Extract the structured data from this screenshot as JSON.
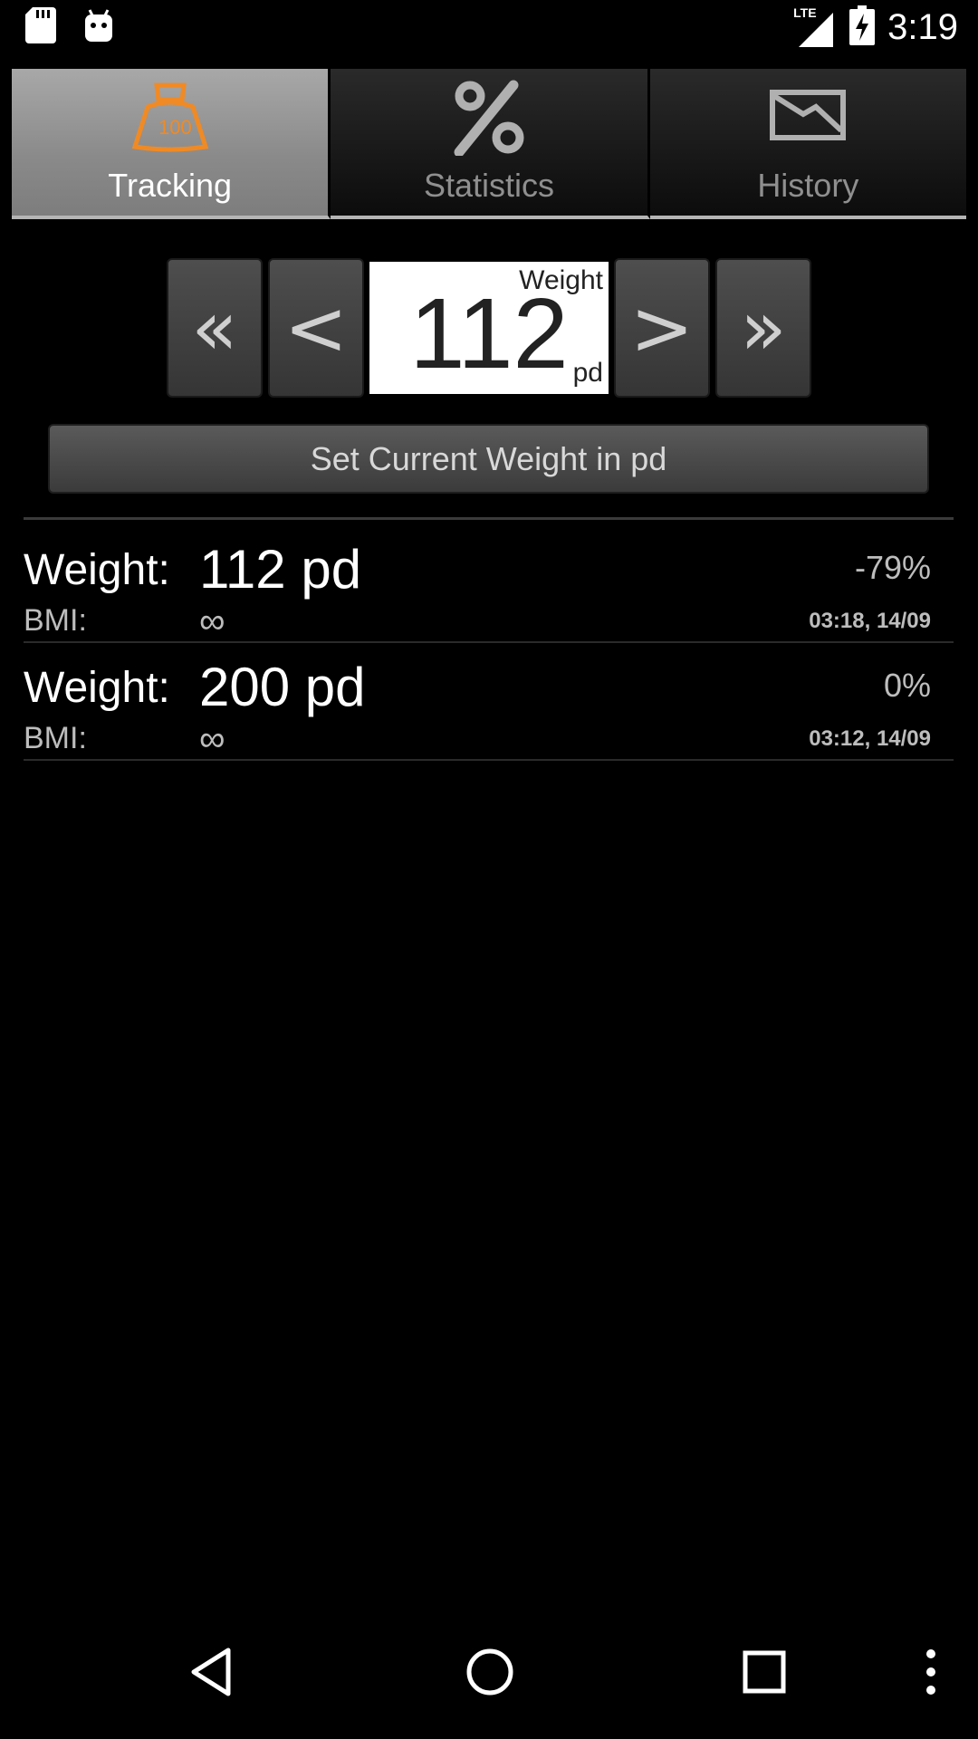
{
  "status_bar": {
    "time": "3:19",
    "network_label": "LTE",
    "icons": [
      "sd-card-icon",
      "android-icon",
      "signal-icon",
      "battery-charging-icon"
    ]
  },
  "tabs": [
    {
      "label": "Tracking",
      "icon": "scale-icon",
      "active": true
    },
    {
      "label": "Statistics",
      "icon": "percent-icon",
      "active": false
    },
    {
      "label": "History",
      "icon": "chart-icon",
      "active": false
    }
  ],
  "stepper": {
    "label": "Weight",
    "value": "112",
    "unit": "pd",
    "buttons": {
      "fast_decrease": "«",
      "decrease": "<",
      "increase": ">",
      "fast_increase": "»"
    }
  },
  "set_button_label": "Set Current Weight in pd",
  "entries": [
    {
      "weight_label": "Weight:",
      "weight": "112 pd",
      "change": "-79%",
      "bmi_label": "BMI:",
      "bmi": "∞",
      "timestamp": "03:18, 14/09"
    },
    {
      "weight_label": "Weight:",
      "weight": "200 pd",
      "change": "0%",
      "bmi_label": "BMI:",
      "bmi": "∞",
      "timestamp": "03:12, 14/09"
    }
  ],
  "nav_bar": [
    "back-icon",
    "home-icon",
    "recents-icon",
    "overflow-menu-icon"
  ],
  "colors": {
    "accent": "#f08a24",
    "background": "#000000"
  }
}
